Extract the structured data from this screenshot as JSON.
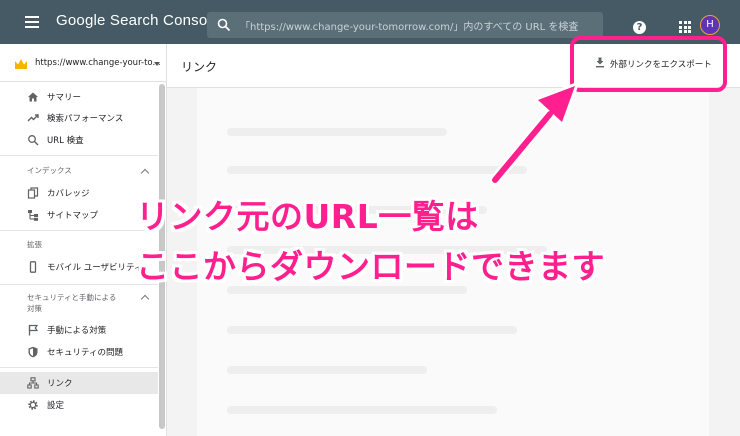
{
  "topbar": {
    "brand": "Google Search Console",
    "search_placeholder": "「https://www.change-your-tomorrow.com/」内のすべての URL を検査",
    "help": "?",
    "avatar_initial": "H"
  },
  "sidebar": {
    "property": "https://www.change-your-to...",
    "items": {
      "summary": "サマリー",
      "performance": "検索パフォーマンス",
      "url_inspection": "URL 検査",
      "coverage": "カバレッジ",
      "sitemaps": "サイトマップ",
      "mobile_usability": "モバイル ユーザビリティ",
      "manual_actions": "手動による対策",
      "security_issues": "セキュリティの問題",
      "links": "リンク",
      "settings": "設定"
    },
    "sections": {
      "index": "インデックス",
      "enhancements": "拡張",
      "security_line1": "セキュリティと手動による",
      "security_line2": "対策"
    }
  },
  "main": {
    "title": "リンク",
    "export_label": "外部リンクをエクスポート"
  },
  "annotation": {
    "line1": "リンク元のURL一覧は",
    "line2": "ここからダウンロードできます"
  },
  "colors": {
    "topbar": "#455a64",
    "accent_pink": "#ff1f8e",
    "active_item": "#e8e8e8"
  }
}
